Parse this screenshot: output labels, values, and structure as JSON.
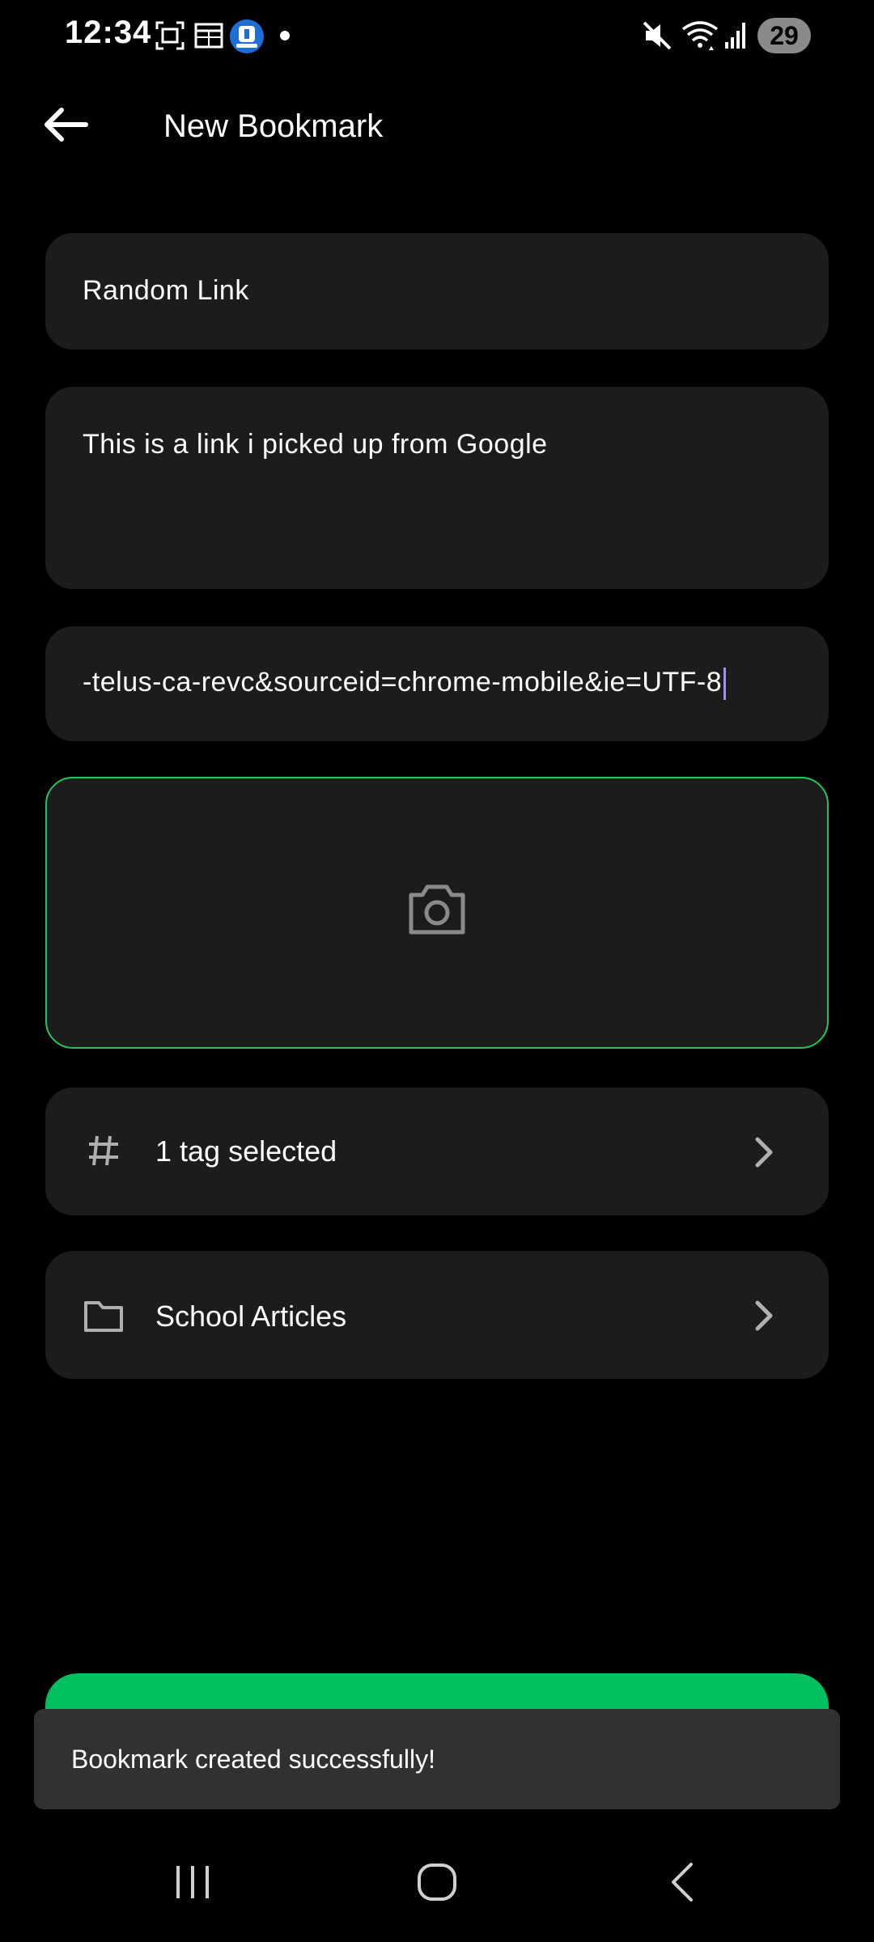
{
  "status_bar": {
    "time": "12:34",
    "battery": "29",
    "icons": [
      "screenshot-icon",
      "calendar-icon",
      "app-notification-icon",
      "dot-icon",
      "mute-icon",
      "wifi-icon",
      "signal-icon"
    ]
  },
  "app_bar": {
    "title": "New Bookmark",
    "back_icon": "arrow-left-icon"
  },
  "form": {
    "name_value": "Random Link",
    "description_value": "This is a link i picked up from Google",
    "url_value": "-telus-ca-revc&sourceid=chrome-mobile&ie=UTF-8",
    "image_icon": "camera-icon",
    "tags_label": "1 tag selected",
    "tags_icon": "hash-icon",
    "folder_label": "School Articles",
    "folder_icon": "folder-icon"
  },
  "colors": {
    "accent": "#00c060",
    "image_border": "#22c55e",
    "caret": "#a78bfa",
    "field_bg": "#1c1c1c",
    "snackbar_bg": "#313131"
  },
  "snackbar": {
    "message": "Bookmark created successfully!"
  },
  "nav_bar": {
    "icons": [
      "recent-apps-icon",
      "home-icon",
      "back-icon"
    ]
  }
}
